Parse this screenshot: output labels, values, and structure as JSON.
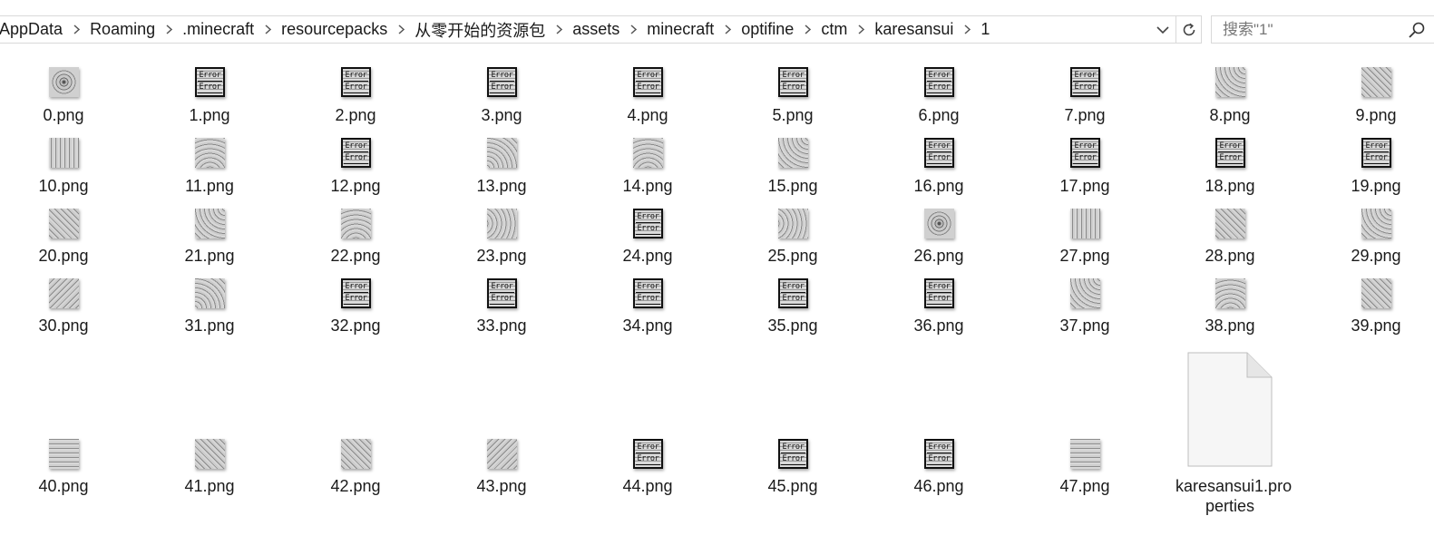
{
  "breadcrumb": [
    "AppData",
    "Roaming",
    ".minecraft",
    "resourcepacks",
    "从零开始的资源包",
    "assets",
    "minecraft",
    "optifine",
    "ctm",
    "karesansui",
    "1"
  ],
  "search": {
    "placeholder": "搜索\"1\""
  },
  "icons": {
    "breadcrumb_separator": "chevron-right-icon",
    "address_dropdown": "chevron-down-icon",
    "refresh": "refresh-icon",
    "search": "search-icon",
    "properties_file": "document-icon"
  },
  "files": [
    {
      "name": "0.png",
      "texture": "circle"
    },
    {
      "name": "1.png",
      "texture": "error"
    },
    {
      "name": "2.png",
      "texture": "error"
    },
    {
      "name": "3.png",
      "texture": "error"
    },
    {
      "name": "4.png",
      "texture": "error"
    },
    {
      "name": "5.png",
      "texture": "error"
    },
    {
      "name": "6.png",
      "texture": "error"
    },
    {
      "name": "7.png",
      "texture": "error"
    },
    {
      "name": "8.png",
      "texture": "arc2"
    },
    {
      "name": "9.png",
      "texture": "diag"
    },
    {
      "name": "10.png",
      "texture": "vstripe"
    },
    {
      "name": "11.png",
      "texture": "arc3"
    },
    {
      "name": "12.png",
      "texture": "error"
    },
    {
      "name": "13.png",
      "texture": "arc"
    },
    {
      "name": "14.png",
      "texture": "arc3"
    },
    {
      "name": "15.png",
      "texture": "arc2"
    },
    {
      "name": "16.png",
      "texture": "error"
    },
    {
      "name": "17.png",
      "texture": "error"
    },
    {
      "name": "18.png",
      "texture": "error"
    },
    {
      "name": "19.png",
      "texture": "error"
    },
    {
      "name": "20.png",
      "texture": "diag"
    },
    {
      "name": "21.png",
      "texture": "arc2"
    },
    {
      "name": "22.png",
      "texture": "arc3"
    },
    {
      "name": "23.png",
      "texture": "arc4"
    },
    {
      "name": "24.png",
      "texture": "error"
    },
    {
      "name": "25.png",
      "texture": "arc4"
    },
    {
      "name": "26.png",
      "texture": "circle"
    },
    {
      "name": "27.png",
      "texture": "vstripe"
    },
    {
      "name": "28.png",
      "texture": "diag"
    },
    {
      "name": "29.png",
      "texture": "arc2"
    },
    {
      "name": "30.png",
      "texture": "diag2"
    },
    {
      "name": "31.png",
      "texture": "arc"
    },
    {
      "name": "32.png",
      "texture": "error"
    },
    {
      "name": "33.png",
      "texture": "error"
    },
    {
      "name": "34.png",
      "texture": "error"
    },
    {
      "name": "35.png",
      "texture": "error"
    },
    {
      "name": "36.png",
      "texture": "error"
    },
    {
      "name": "37.png",
      "texture": "arc2"
    },
    {
      "name": "38.png",
      "texture": "arc3"
    },
    {
      "name": "39.png",
      "texture": "diag"
    },
    {
      "name": "40.png",
      "texture": "hstripe"
    },
    {
      "name": "41.png",
      "texture": "diag"
    },
    {
      "name": "42.png",
      "texture": "diag"
    },
    {
      "name": "43.png",
      "texture": "diag2"
    },
    {
      "name": "44.png",
      "texture": "error"
    },
    {
      "name": "45.png",
      "texture": "error"
    },
    {
      "name": "46.png",
      "texture": "error"
    },
    {
      "name": "47.png",
      "texture": "hstripe"
    }
  ],
  "error_texture_text": [
    "Error",
    "Error"
  ],
  "properties_file": {
    "name_line1": "karesansui1.pro",
    "name_line2": "perties"
  }
}
